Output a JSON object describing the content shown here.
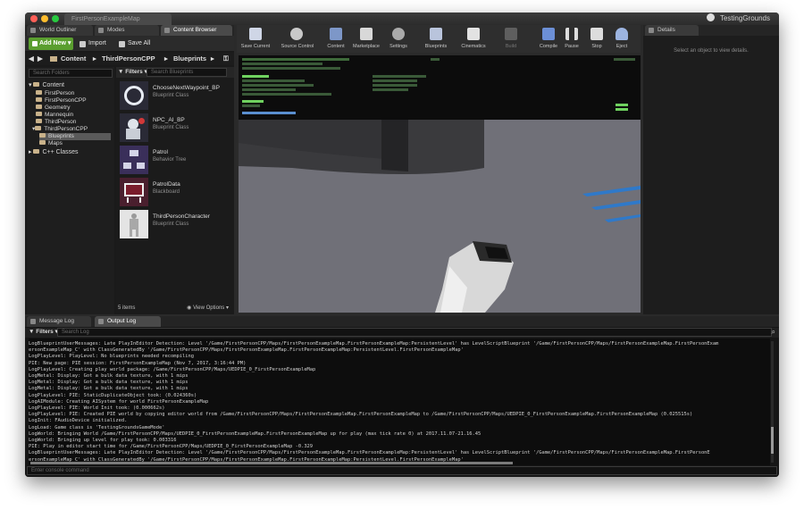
{
  "window": {
    "document_tab": "FirstPersonExampleMap",
    "app_title": "TestingGrounds"
  },
  "left_tabs": {
    "world_outliner": "World Outliner",
    "modes": "Modes",
    "content_browser": "Content Browser"
  },
  "cb_toolbar": {
    "add_new": "Add New",
    "import": "Import",
    "save_all": "Save All"
  },
  "cb_path": {
    "root": "Content",
    "crumb1": "ThirdPersonCPP",
    "crumb2": "Blueprints"
  },
  "sources": {
    "search_placeholder": "Search Folders",
    "tree": {
      "content": "Content",
      "firstperson": "FirstPerson",
      "firstpersoncpp": "FirstPersonCPP",
      "geometry": "Geometry",
      "mannequin": "Mannequin",
      "thirdperson": "ThirdPerson",
      "thirdpersoncpp": "ThirdPersonCPP",
      "blueprints": "Blueprints",
      "maps": "Maps",
      "cpp_classes": "C++ Classes"
    }
  },
  "assets": {
    "filters_label": "Filters",
    "search_placeholder": "Search Blueprints",
    "items": [
      {
        "name": "ChooseNextWaypoint_BP",
        "type": "Blueprint Class"
      },
      {
        "name": "NPC_AI_BP",
        "type": "Blueprint Class"
      },
      {
        "name": "Patrol",
        "type": "Behavior Tree"
      },
      {
        "name": "PatrolData",
        "type": "Blackboard"
      },
      {
        "name": "ThirdPersonCharacter",
        "type": "Blueprint Class"
      }
    ],
    "count": "5 items",
    "view_options": "View Options"
  },
  "main_toolbar": {
    "save_current": "Save Current",
    "source_control": "Source Control",
    "content": "Content",
    "marketplace": "Marketplace",
    "settings": "Settings",
    "blueprints": "Blueprints",
    "cinematics": "Cinematics",
    "build": "Build",
    "compile": "Compile",
    "pause": "Pause",
    "stop": "Stop",
    "eject": "Eject"
  },
  "details": {
    "tab": "Details",
    "hint": "Select an object to view details."
  },
  "bottom_tabs": {
    "message_log": "Message Log",
    "output_log": "Output Log"
  },
  "output": {
    "filters_label": "Filters",
    "search_placeholder": "Search Log",
    "console_placeholder": "Enter console command",
    "lines": [
      "LogBlueprintUserMessages: Late PlayInEditor Detection: Level '/Game/FirstPersonCPP/Maps/FirstPersonExampleMap.FirstPersonExampleMap:PersistentLevel' has LevelScriptBlueprint '/Game/FirstPersonCPP/Maps/FirstPersonExampleMap.FirstPersonExam",
      "ersonExampleMap_C' with ClassGeneratedBy '/Game/FirstPersonCPP/Maps/FirstPersonExampleMap.FirstPersonExampleMap:PersistentLevel.FirstPersonExampleMap'",
      "LogPlayLevel: PlayLevel: No blueprints needed recompiling",
      "PIE: New page: PIE session: FirstPersonExampleMap (Nov 7, 2017, 3:16:44 PM)",
      "LogPlayLevel: Creating play world package: /Game/FirstPersonCPP/Maps/UEDPIE_0_FirstPersonExampleMap",
      "LogMetal: Display: Got a bulk data texture, with 1 mips",
      "LogMetal: Display: Got a bulk data texture, with 1 mips",
      "LogMetal: Display: Got a bulk data texture, with 1 mips",
      "LogPlayLevel: PIE: StaticDuplicateObject took: (0.024360s)",
      "LogAIModule: Creating AISystem for world FirstPersonExampleMap",
      "LogPlayLevel: PIE: World Init took: (0.000662s)",
      "LogPlayLevel: PIE: Created PIE world by copying editor world from /Game/FirstPersonCPP/Maps/FirstPersonExampleMap.FirstPersonExampleMap to /Game/FirstPersonCPP/Maps/UEDPIE_0_FirstPersonExampleMap.FirstPersonExampleMap (0.025515s)",
      "LogInit: FAudioDevice initialized.",
      "LogLoad: Game class is 'TestingGroundsGameMode'",
      "LogWorld: Bringing World /Game/FirstPersonCPP/Maps/UEDPIE_0_FirstPersonExampleMap.FirstPersonExampleMap up for play (max tick rate 0) at 2017.11.07-21.16.45",
      "LogWorld: Bringing up level for play took: 0.003316",
      "PIE: Play in editor start time for /Game/FirstPersonCPP/Maps/UEDPIE_0_FirstPersonExampleMap -0.329",
      "LogBlueprintUserMessages: Late PlayInEditor Detection: Level '/Game/FirstPersonCPP/Maps/FirstPersonExampleMap.FirstPersonExampleMap:PersistentLevel' has LevelScriptBlueprint '/Game/FirstPersonCPP/Maps/FirstPersonExampleMap.FirstPersonE",
      "ersonExampleMap_C' with ClassGeneratedBy '/Game/FirstPersonCPP/Maps/FirstPersonExampleMap.FirstPersonExampleMap:PersistentLevel.FirstPersonExampleMap'"
    ]
  }
}
